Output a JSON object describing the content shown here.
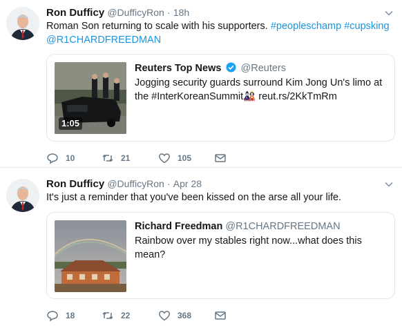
{
  "tweets": [
    {
      "name": "Ron Dufficy",
      "handle": "@DufficyRon",
      "separator": "·",
      "time": "18h",
      "text_plain": "Roman Son returning to scale with his supporters. ",
      "hashtags": [
        "#peopleschamp",
        "#cupsking"
      ],
      "mention": "@R1CHARDFREEDMAN",
      "quote": {
        "name": "Reuters Top News",
        "verified": true,
        "handle": "@Reuters",
        "text": "Jogging security guards surround Kim Jong Un's limo at the #InterKoreanSummit",
        "emoji": "🎎",
        "link": "reut.rs/2KkTmRm",
        "duration": "1:05"
      },
      "actions": {
        "replies": "10",
        "retweets": "21",
        "likes": "105"
      }
    },
    {
      "name": "Ron Dufficy",
      "handle": "@DufficyRon",
      "separator": "·",
      "time": "Apr 28",
      "text": "It's just a reminder that you've been kissed on the arse all your life.",
      "quote": {
        "name": "Richard Freedman",
        "handle": "@R1CHARDFREEDMAN",
        "text": "Rainbow over my stables right now...what does this mean?"
      },
      "actions": {
        "replies": "18",
        "retweets": "22",
        "likes": "368"
      }
    }
  ],
  "colors": {
    "link": "#1b95e0",
    "muted": "#657786",
    "text": "#14171a",
    "border": "#e1e8ed",
    "verified": "#1da1f2"
  },
  "icons": [
    "user-avatar",
    "chevron-down-icon",
    "verified-badge-icon",
    "reply-icon",
    "retweet-icon",
    "like-icon",
    "direct-message-icon"
  ]
}
